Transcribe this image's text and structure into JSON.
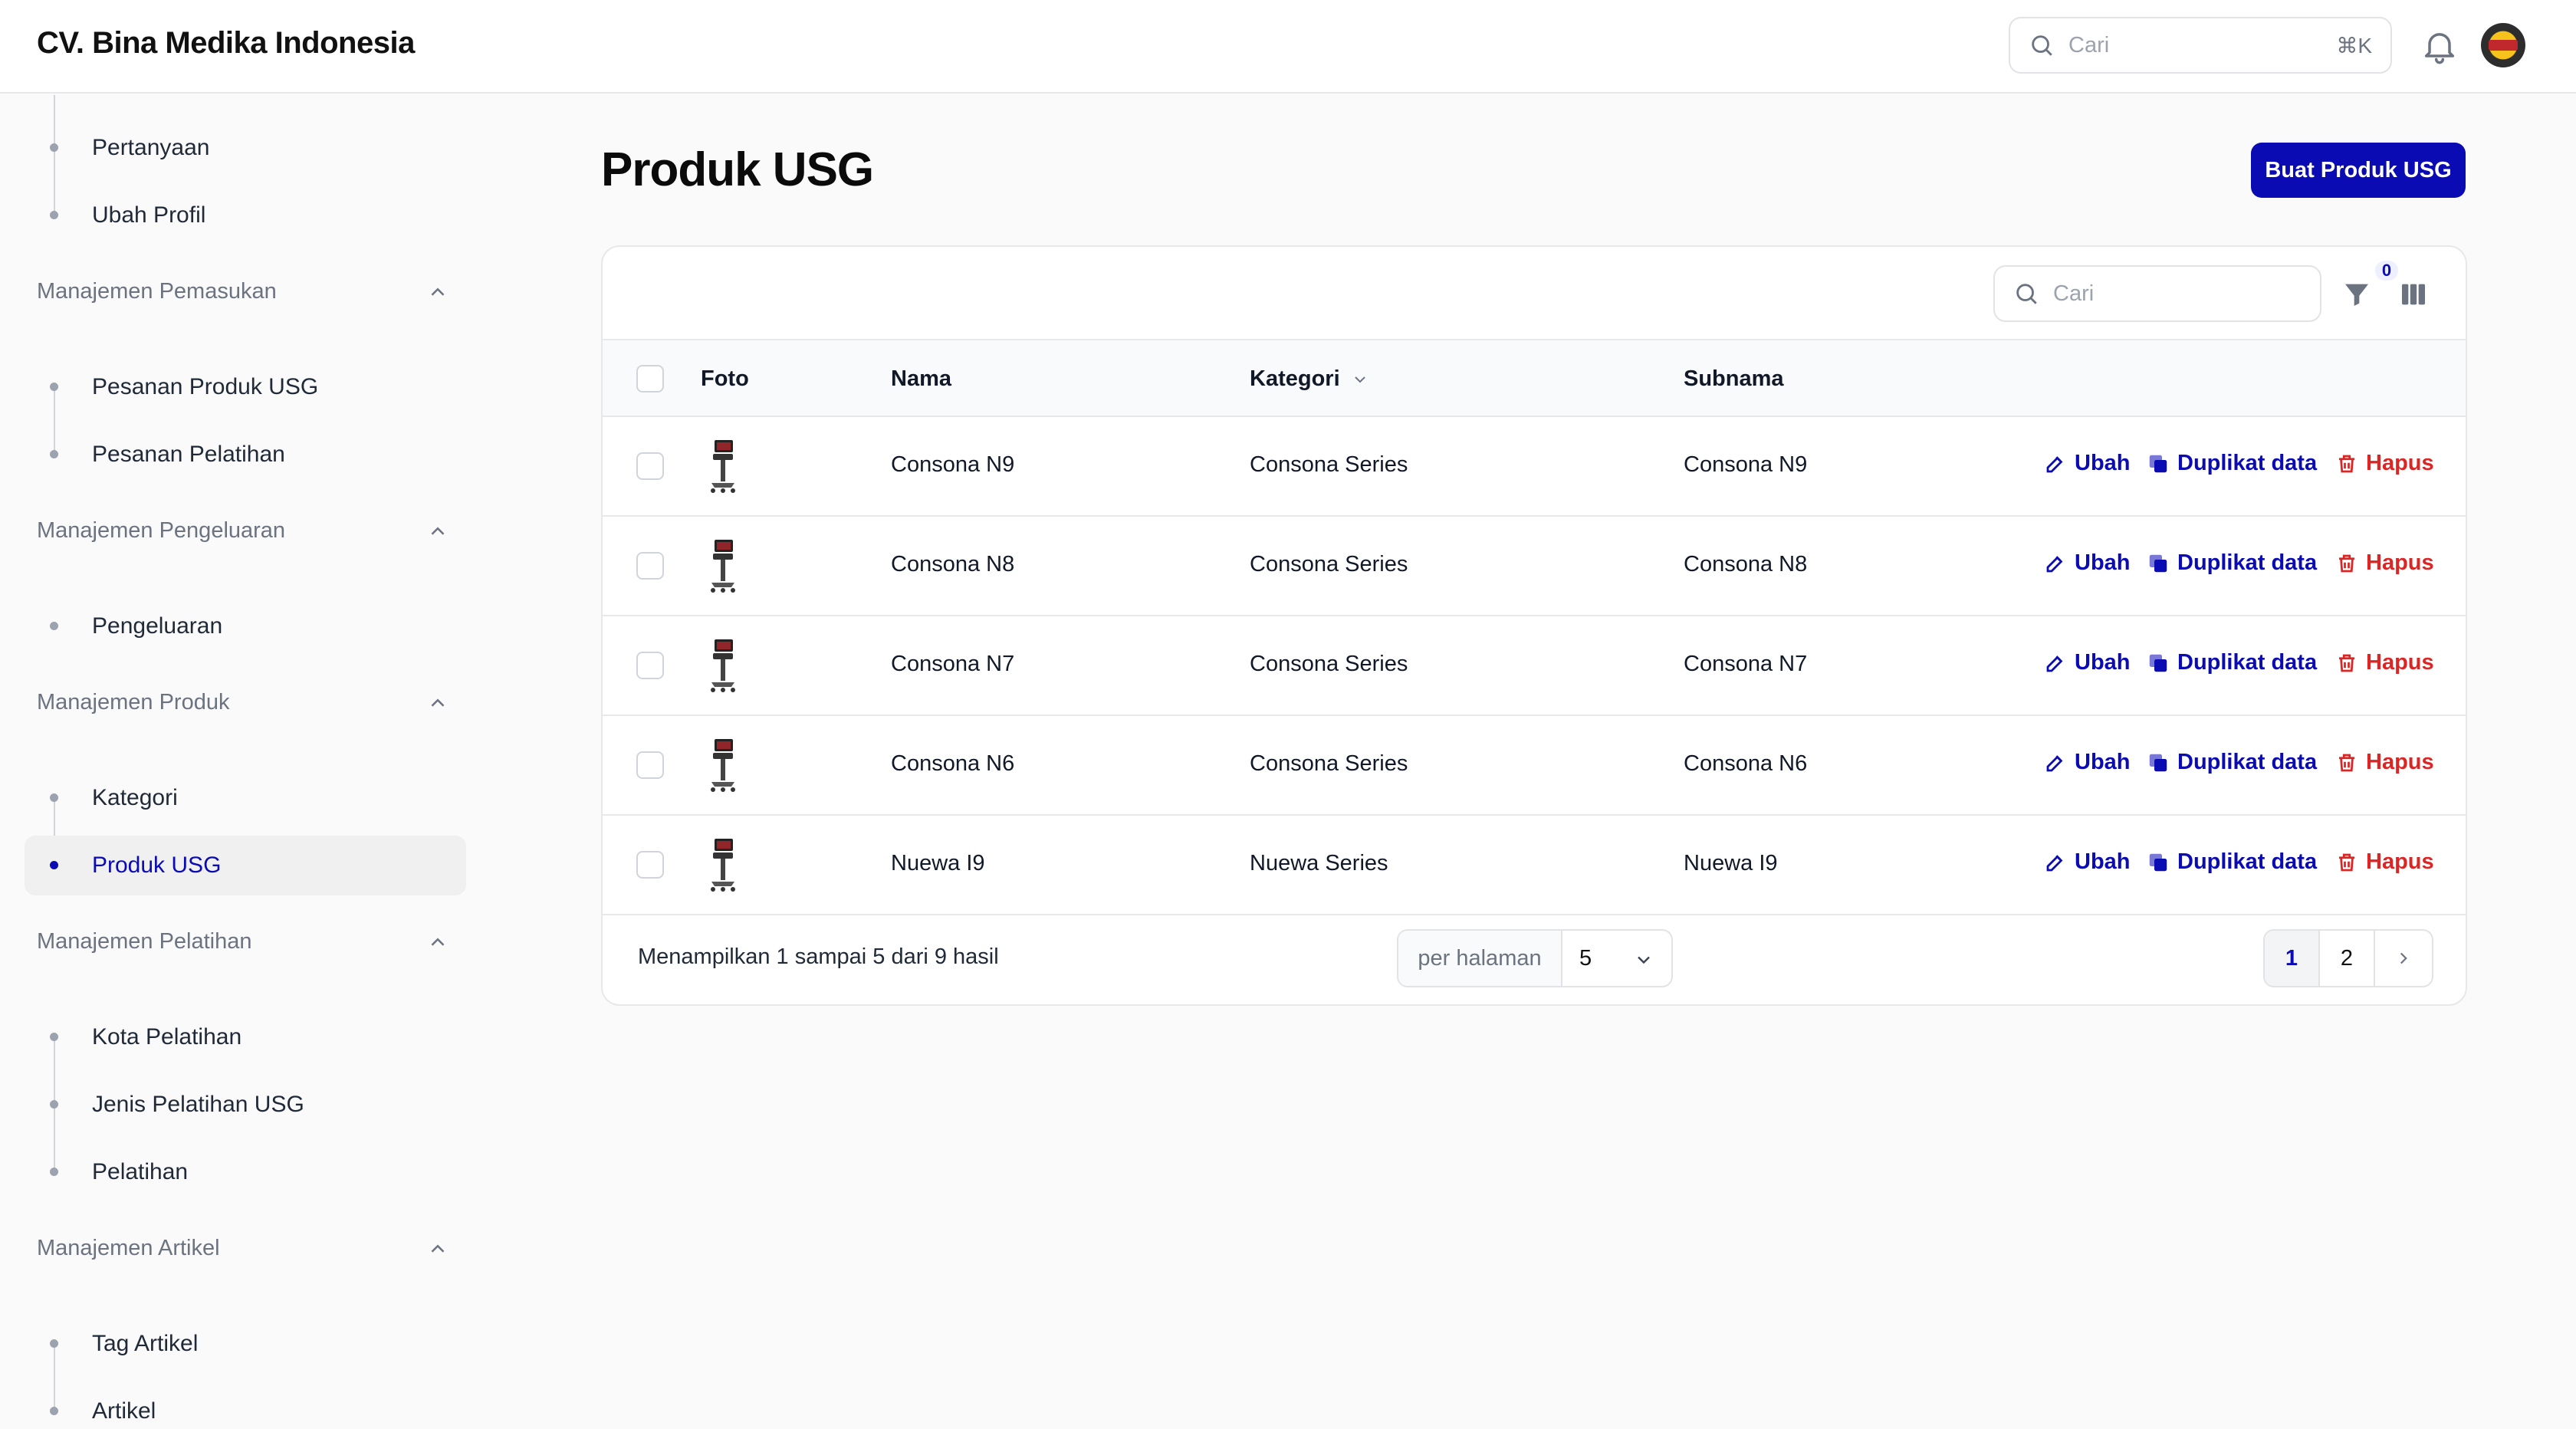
{
  "header": {
    "brand": "CV. Bina Medika Indonesia",
    "search_placeholder": "Cari",
    "search_shortcut": "⌘K"
  },
  "sidebar": {
    "groups": [
      {
        "title": "",
        "items": [
          {
            "label": "Pertanyaan"
          },
          {
            "label": "Ubah Profil"
          }
        ]
      },
      {
        "title": "Manajemen Pemasukan",
        "items": [
          {
            "label": "Pesanan Produk USG"
          },
          {
            "label": "Pesanan Pelatihan"
          }
        ]
      },
      {
        "title": "Manajemen Pengeluaran",
        "items": [
          {
            "label": "Pengeluaran"
          }
        ]
      },
      {
        "title": "Manajemen Produk",
        "items": [
          {
            "label": "Kategori"
          },
          {
            "label": "Produk USG",
            "active": true
          }
        ]
      },
      {
        "title": "Manajemen Pelatihan",
        "items": [
          {
            "label": "Kota Pelatihan"
          },
          {
            "label": "Jenis Pelatihan USG"
          },
          {
            "label": "Pelatihan"
          }
        ]
      },
      {
        "title": "Manajemen Artikel",
        "items": [
          {
            "label": "Tag Artikel"
          },
          {
            "label": "Artikel"
          }
        ]
      }
    ]
  },
  "main": {
    "title": "Produk USG",
    "create_label": "Buat Produk USG",
    "table_search_placeholder": "Cari",
    "filter_count": "0",
    "columns": {
      "photo": "Foto",
      "name": "Nama",
      "category": "Kategori",
      "subname": "Subnama"
    },
    "actions": {
      "edit": "Ubah",
      "duplicate": "Duplikat data",
      "delete": "Hapus"
    },
    "rows": [
      {
        "name": "Consona N9",
        "category": "Consona Series",
        "subname": "Consona N9"
      },
      {
        "name": "Consona N8",
        "category": "Consona Series",
        "subname": "Consona N8"
      },
      {
        "name": "Consona N7",
        "category": "Consona Series",
        "subname": "Consona N7"
      },
      {
        "name": "Consona N6",
        "category": "Consona Series",
        "subname": "Consona N6"
      },
      {
        "name": "Nuewa I9",
        "category": "Nuewa Series",
        "subname": "Nuewa I9"
      }
    ],
    "pagination": {
      "summary": "Menampilkan 1 sampai 5 dari 9 hasil",
      "per_page_label": "per halaman",
      "per_page_value": "5",
      "pages": [
        "1",
        "2"
      ],
      "current_page": "1"
    }
  },
  "colors": {
    "accent": "#0b0bb3",
    "danger": "#dc2626"
  }
}
